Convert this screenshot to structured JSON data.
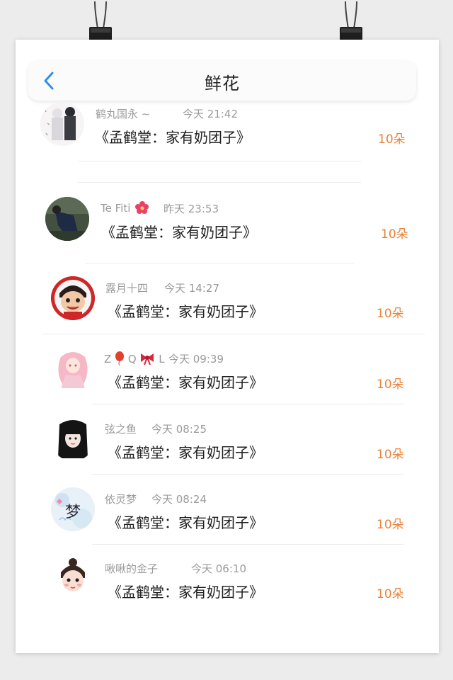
{
  "header": {
    "title": "鲜花"
  },
  "records": [
    {
      "user": "鹤丸国永 ~",
      "time": "今天 21:42",
      "book": "《孟鹤堂：家有奶团子》",
      "amount": "10朵"
    },
    {
      "user": "Te Fiti",
      "time": "昨天 23:53",
      "book": "《孟鹤堂：家有奶团子》",
      "amount": "10朵"
    },
    {
      "user": "露月十四",
      "time": "今天 14:27",
      "book": "《孟鹤堂：家有奶团子》",
      "amount": "10朵"
    },
    {
      "user": "Z",
      "user_b": "Q",
      "user_c": "L",
      "time": "今天 09:39",
      "book": "《孟鹤堂：家有奶团子》",
      "amount": "10朵"
    },
    {
      "user": "弦之鱼",
      "time": "今天 08:25",
      "book": "《孟鹤堂：家有奶团子》",
      "amount": "10朵"
    },
    {
      "user": "依灵梦",
      "time": "今天 08:24",
      "book": "《孟鹤堂：家有奶团子》",
      "amount": "10朵",
      "avatar_text": "梦"
    },
    {
      "user": "啾啾的金子",
      "time": "今天 06:10",
      "book": "《孟鹤堂：家有奶团子》",
      "amount": "10朵"
    }
  ],
  "colors": {
    "accent_blue": "#2f8ef0",
    "amount_orange": "#e8823a"
  }
}
